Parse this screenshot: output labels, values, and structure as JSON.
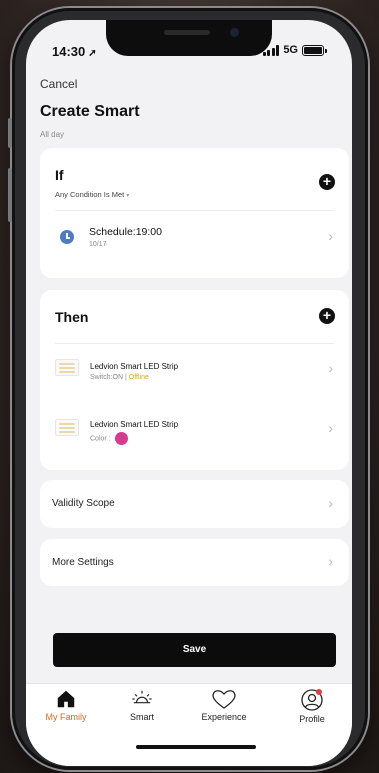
{
  "status": {
    "time": "14:30",
    "network": "5G"
  },
  "header": {
    "cancel": "Cancel",
    "title": "Create Smart",
    "subtitle": "All day"
  },
  "if_card": {
    "heading": "If",
    "condition": "Any Condition Is Met",
    "schedule_title": "Schedule:19:00",
    "schedule_date": "10/17"
  },
  "then_card": {
    "heading": "Then",
    "devices": [
      {
        "name": "Ledvion Smart LED Strip",
        "status_prefix": "Switch:ON | ",
        "status_flag": "Offline"
      },
      {
        "name": "Ledvion Smart LED Strip",
        "status_prefix": "Color :",
        "color": "#d63b8f"
      }
    ]
  },
  "rows": {
    "validity": "Validity Scope",
    "more": "More Settings"
  },
  "save_label": "Save",
  "tabs": [
    {
      "label": "My Family",
      "icon": "home-icon",
      "active": true
    },
    {
      "label": "Smart",
      "icon": "sun-icon"
    },
    {
      "label": "Experience",
      "icon": "heart-icon"
    },
    {
      "label": "Profile",
      "icon": "profile-icon",
      "badge": true
    }
  ],
  "colors": {
    "accent": "#d66a1d",
    "badge": "#e0403a",
    "offline": "#e8a317"
  }
}
